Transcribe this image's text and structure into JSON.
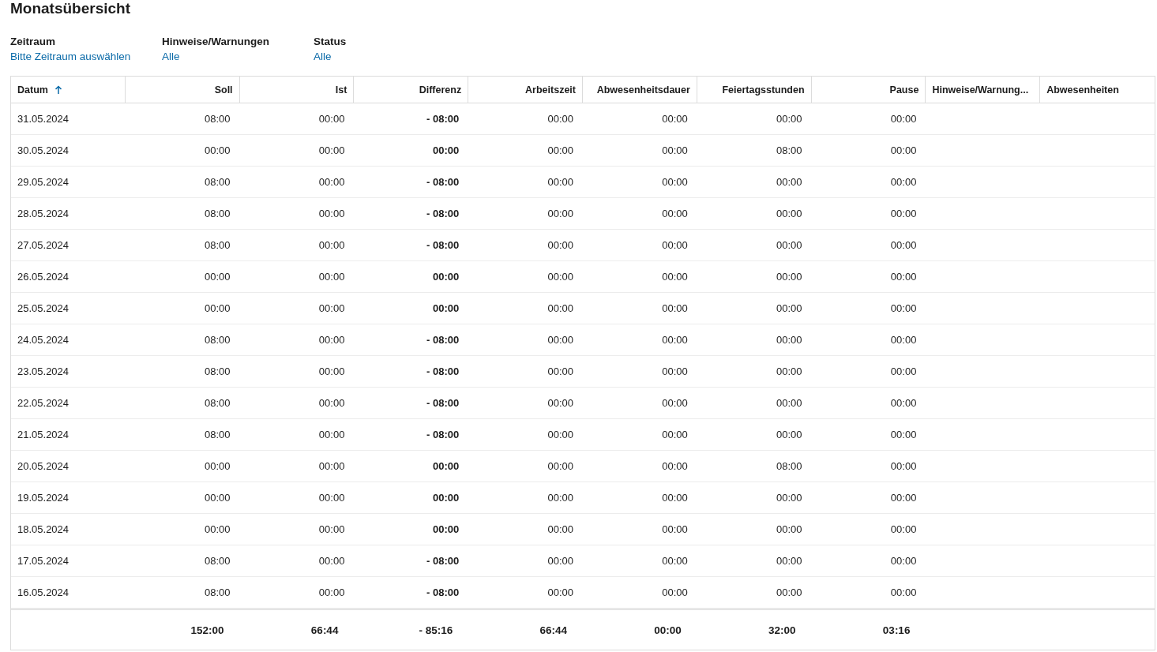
{
  "title": "Monatsübersicht",
  "filters": [
    {
      "label": "Zeitraum",
      "value": "Bitte Zeitraum auswählen"
    },
    {
      "label": "Hinweise/Warnungen",
      "value": "Alle"
    },
    {
      "label": "Status",
      "value": "Alle"
    }
  ],
  "table": {
    "columns": [
      {
        "label": "Datum",
        "sorted": true
      },
      {
        "label": "Soll"
      },
      {
        "label": "Ist"
      },
      {
        "label": "Differenz"
      },
      {
        "label": "Arbeitszeit"
      },
      {
        "label": "Abwesenheitsdauer"
      },
      {
        "label": "Feiertagsstunden"
      },
      {
        "label": "Pause"
      },
      {
        "label": "Hinweise/Warnung..."
      },
      {
        "label": "Abwesenheiten"
      }
    ],
    "rows": [
      [
        "31.05.2024",
        "08:00",
        "00:00",
        "- 08:00",
        "00:00",
        "00:00",
        "00:00",
        "00:00"
      ],
      [
        "30.05.2024",
        "00:00",
        "00:00",
        "00:00",
        "00:00",
        "00:00",
        "08:00",
        "00:00"
      ],
      [
        "29.05.2024",
        "08:00",
        "00:00",
        "- 08:00",
        "00:00",
        "00:00",
        "00:00",
        "00:00"
      ],
      [
        "28.05.2024",
        "08:00",
        "00:00",
        "- 08:00",
        "00:00",
        "00:00",
        "00:00",
        "00:00"
      ],
      [
        "27.05.2024",
        "08:00",
        "00:00",
        "- 08:00",
        "00:00",
        "00:00",
        "00:00",
        "00:00"
      ],
      [
        "26.05.2024",
        "00:00",
        "00:00",
        "00:00",
        "00:00",
        "00:00",
        "00:00",
        "00:00"
      ],
      [
        "25.05.2024",
        "00:00",
        "00:00",
        "00:00",
        "00:00",
        "00:00",
        "00:00",
        "00:00"
      ],
      [
        "24.05.2024",
        "08:00",
        "00:00",
        "- 08:00",
        "00:00",
        "00:00",
        "00:00",
        "00:00"
      ],
      [
        "23.05.2024",
        "08:00",
        "00:00",
        "- 08:00",
        "00:00",
        "00:00",
        "00:00",
        "00:00"
      ],
      [
        "22.05.2024",
        "08:00",
        "00:00",
        "- 08:00",
        "00:00",
        "00:00",
        "00:00",
        "00:00"
      ],
      [
        "21.05.2024",
        "08:00",
        "00:00",
        "- 08:00",
        "00:00",
        "00:00",
        "00:00",
        "00:00"
      ],
      [
        "20.05.2024",
        "00:00",
        "00:00",
        "00:00",
        "00:00",
        "00:00",
        "08:00",
        "00:00"
      ],
      [
        "19.05.2024",
        "00:00",
        "00:00",
        "00:00",
        "00:00",
        "00:00",
        "00:00",
        "00:00"
      ],
      [
        "18.05.2024",
        "00:00",
        "00:00",
        "00:00",
        "00:00",
        "00:00",
        "00:00",
        "00:00"
      ],
      [
        "17.05.2024",
        "08:00",
        "00:00",
        "- 08:00",
        "00:00",
        "00:00",
        "00:00",
        "00:00"
      ],
      [
        "16.05.2024",
        "08:00",
        "00:00",
        "- 08:00",
        "00:00",
        "00:00",
        "00:00",
        "00:00"
      ]
    ],
    "totals": [
      "152:00",
      "66:44",
      "- 85:16",
      "66:44",
      "00:00",
      "32:00",
      "03:16"
    ]
  }
}
